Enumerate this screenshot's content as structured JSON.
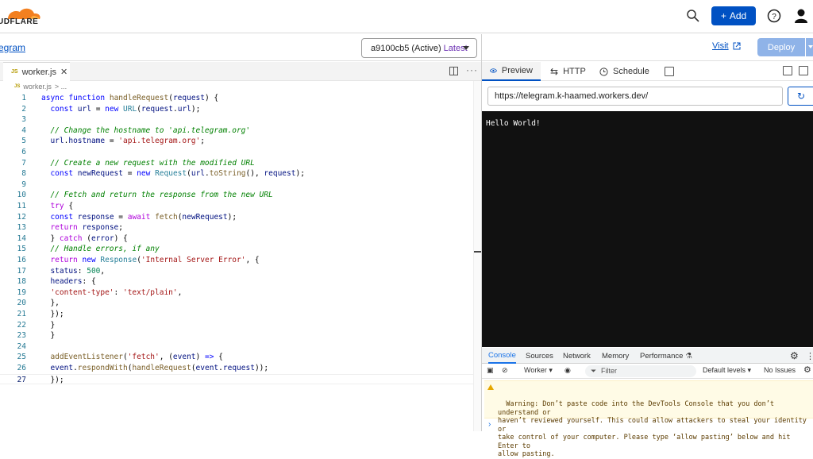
{
  "header": {
    "logo_text": "UDFLARE",
    "add_label": "Add"
  },
  "worker_bar": {
    "breadcrumb": "egram",
    "version_id": "a9100cb5",
    "version_status": "(Active)",
    "version_tag": "Latest"
  },
  "editor": {
    "tab_label": "worker.js",
    "js_badge": "JS",
    "subcrumb_file": "worker.js",
    "subcrumb_more": "> ...",
    "lines": [
      {
        "num": "1",
        "html": "<span class='k'>async</span> <span class='k'>function</span> <span class='f'>handleRequest</span>(<span class='v'>request</span>) {"
      },
      {
        "num": "2",
        "html": "  <span class='k'>const</span> <span class='v'>url</span> = <span class='k'>new</span> <span class='t'>URL</span>(<span class='v'>request</span>.<span class='v'>url</span>);"
      },
      {
        "num": "3",
        "html": ""
      },
      {
        "num": "4",
        "html": "  <span class='c'>// Change the hostname to 'api.telegram.org'</span>"
      },
      {
        "num": "5",
        "html": "  <span class='v'>url</span>.<span class='v'>hostname</span> = <span class='s'>'api.telegram.org'</span>;"
      },
      {
        "num": "6",
        "html": ""
      },
      {
        "num": "7",
        "html": "  <span class='c'>// Create a new request with the modified URL</span>"
      },
      {
        "num": "8",
        "html": "  <span class='k'>const</span> <span class='v'>newRequest</span> = <span class='k'>new</span> <span class='t'>Request</span>(<span class='v'>url</span>.<span class='f'>toString</span>(), <span class='v'>request</span>);"
      },
      {
        "num": "9",
        "html": ""
      },
      {
        "num": "10",
        "html": "  <span class='c'>// Fetch and return the response from the new URL</span>"
      },
      {
        "num": "11",
        "html": "  <span class='kw2'>try</span> {"
      },
      {
        "num": "12",
        "html": "  <span class='k'>const</span> <span class='v'>response</span> = <span class='kw2'>await</span> <span class='f'>fetch</span>(<span class='v'>newRequest</span>);"
      },
      {
        "num": "13",
        "html": "  <span class='kw2'>return</span> <span class='v'>response</span>;"
      },
      {
        "num": "14",
        "html": "  } <span class='kw2'>catch</span> (<span class='v'>error</span>) {"
      },
      {
        "num": "15",
        "html": "  <span class='c'>// Handle errors, if any</span>"
      },
      {
        "num": "16",
        "html": "  <span class='kw2'>return</span> <span class='k'>new</span> <span class='t'>Response</span>(<span class='s'>'Internal Server Error'</span>, {"
      },
      {
        "num": "17",
        "html": "  <span class='v'>status</span>: <span class='n'>500</span>,"
      },
      {
        "num": "18",
        "html": "  <span class='v'>headers</span>: {"
      },
      {
        "num": "19",
        "html": "  <span class='s'>'content-type'</span>: <span class='s'>'text/plain'</span>,"
      },
      {
        "num": "20",
        "html": "  },"
      },
      {
        "num": "21",
        "html": "  });"
      },
      {
        "num": "22",
        "html": "  }"
      },
      {
        "num": "23",
        "html": "  }"
      },
      {
        "num": "24",
        "html": ""
      },
      {
        "num": "25",
        "html": "  <span class='f'>addEventListener</span>(<span class='s'>'fetch'</span>, (<span class='v'>event</span>) <span class='k'>=&gt;</span> {"
      },
      {
        "num": "26",
        "html": "  <span class='v'>event</span>.<span class='f'>respondWith</span>(<span class='f'>handleRequest</span>(<span class='v'>event</span>.<span class='v'>request</span>));"
      },
      {
        "num": "27",
        "html": "  });"
      }
    ]
  },
  "right_panel": {
    "visit_label": "Visit",
    "deploy_label": "Deploy",
    "tabs": [
      "Preview",
      "HTTP",
      "Schedule"
    ],
    "url": "https://telegram.k-haamed.workers.dev/",
    "preview_output": "Hello World!"
  },
  "devtools": {
    "tabs": [
      "Console",
      "Sources",
      "Network",
      "Memory",
      "Performance"
    ],
    "context": "Worker",
    "filter_placeholder": "Filter",
    "levels": "Default levels",
    "issues": "No Issues",
    "warning": "Warning: Don’t paste code into the DevTools Console that you don’t understand or\nhaven’t reviewed yourself. This could allow attackers to steal your identity or\ntake control of your computer. Please type ‘allow pasting’ below and hit Enter to\nallow pasting.",
    "prompt": "›"
  },
  "colors": {
    "accent": "#0051c3",
    "logo_orange": "#f38020",
    "deploy_disabled": "#8fb3e8"
  }
}
